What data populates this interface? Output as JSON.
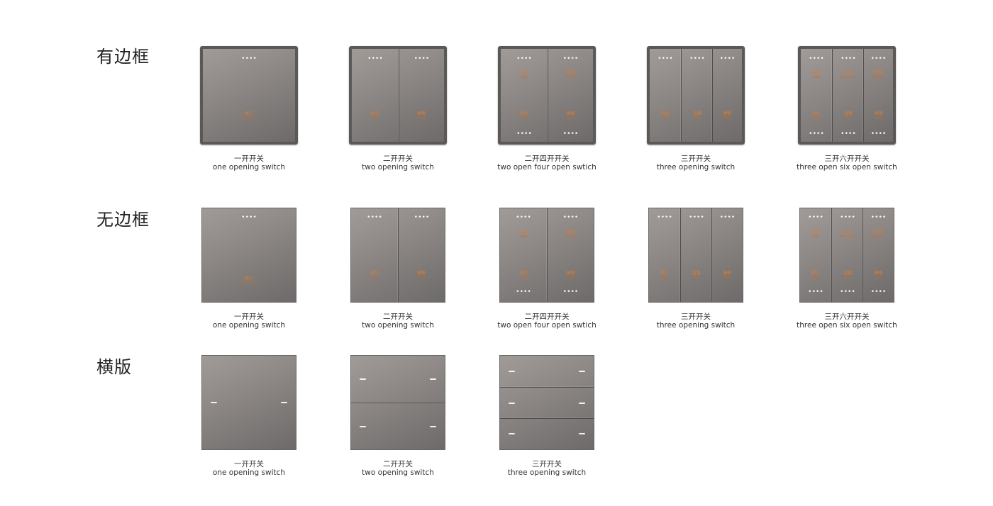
{
  "rows": {
    "framed": {
      "title": "有边框"
    },
    "frameless": {
      "title": "无边框"
    },
    "horizontal": {
      "title": "横版"
    }
  },
  "captions": {
    "one": {
      "zh": "一开开关",
      "en": "one opening switch"
    },
    "two": {
      "zh": "二开开关",
      "en": "two opening switch"
    },
    "two_four": {
      "zh": "二开四开开关",
      "en": "two open four open swtich"
    },
    "three": {
      "zh": "三开开关",
      "en": "three opening switch"
    },
    "three_six": {
      "zh": "三开六开开关",
      "en": "three open six open switch"
    }
  },
  "panel_labels": {
    "indicator": "••••",
    "one": {
      "zh": "射灯",
      "en": "Spot Lamp"
    },
    "two_left": {
      "zh": "射灯",
      "en": "Light"
    },
    "two_right": {
      "zh": "睡眠",
      "en": "Sleep"
    },
    "four_tl": {
      "zh": "灯光",
      "en": "Light"
    },
    "four_tr": {
      "zh": "窗帘",
      "en": "Curtain"
    },
    "four_bl": {
      "zh": "射灯",
      "en": "Light"
    },
    "four_br": {
      "zh": "睡眠",
      "en": "Sleep"
    },
    "three_l": {
      "zh": "射灯",
      "en": "Light"
    },
    "three_m": {
      "zh": "温馨",
      "en": "Cozy"
    },
    "three_r": {
      "zh": "睡眠",
      "en": "Sleep"
    },
    "six_tl": {
      "zh": "灯光",
      "en": "Light"
    },
    "six_tm": {
      "zh": "主灯",
      "en": "Main Lamp"
    },
    "six_tr": {
      "zh": "窗帘",
      "en": "Curtain"
    },
    "six_bl": {
      "zh": "射灯",
      "en": "Light"
    },
    "six_bm": {
      "zh": "温馨",
      "en": "Cozy"
    },
    "six_br": {
      "zh": "睡眠",
      "en": "Sleep"
    }
  },
  "colors": {
    "panel": "#8d8886",
    "frame": "#5b5958",
    "label": "#e07a2a",
    "indicator": "#f3f3f3"
  }
}
